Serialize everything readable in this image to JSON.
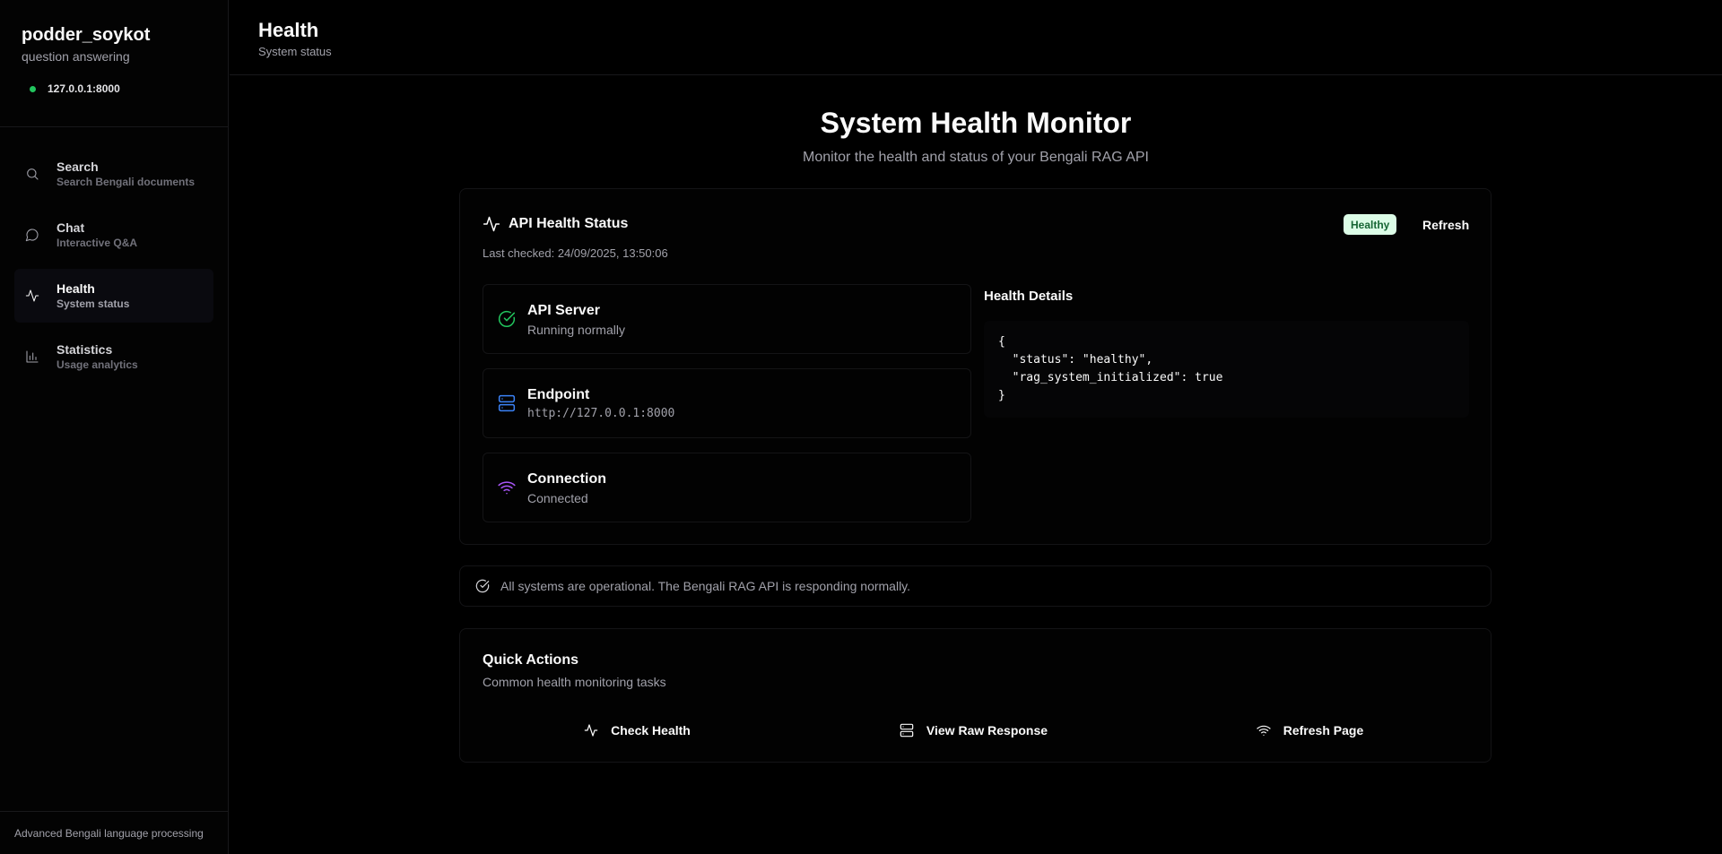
{
  "sidebar": {
    "brand_title": "podder_soykot",
    "brand_subtitle": "question answering",
    "server_address": "127.0.0.1:8000",
    "server_status_color": "#22c55e",
    "items": [
      {
        "label": "Search",
        "description": "Search Bengali documents",
        "icon": "search-icon",
        "active": false
      },
      {
        "label": "Chat",
        "description": "Interactive Q&A",
        "icon": "chat-icon",
        "active": false
      },
      {
        "label": "Health",
        "description": "System status",
        "icon": "activity-icon",
        "active": true
      },
      {
        "label": "Statistics",
        "description": "Usage analytics",
        "icon": "bar-chart-icon",
        "active": false
      }
    ],
    "footer": "Advanced Bengali language processing"
  },
  "header": {
    "title": "Health",
    "subtitle": "System status"
  },
  "hero": {
    "title": "System Health Monitor",
    "subtitle": "Monitor the health and status of your Bengali RAG API"
  },
  "health_card": {
    "title": "API Health Status",
    "last_checked": "Last checked: 24/09/2025, 13:50:06",
    "badge": "Healthy",
    "badge_color": "#dcfce7",
    "refresh_label": "Refresh",
    "items": [
      {
        "title": "API Server",
        "value": "Running normally",
        "icon": "check-circle-icon",
        "color": "#22c55e"
      },
      {
        "title": "Endpoint",
        "value": "http://127.0.0.1:8000",
        "icon": "server-icon",
        "color": "#3b82f6"
      },
      {
        "title": "Connection",
        "value": "Connected",
        "icon": "wifi-icon",
        "color": "#a855f7"
      }
    ],
    "details_title": "Health Details",
    "details_json": "{\n  \"status\": \"healthy\",\n  \"rag_system_initialized\": true\n}"
  },
  "alert": {
    "text": "All systems are operational. The Bengali RAG API is responding normally."
  },
  "quick_actions": {
    "title": "Quick Actions",
    "subtitle": "Common health monitoring tasks",
    "buttons": [
      {
        "label": "Check Health",
        "icon": "activity-icon"
      },
      {
        "label": "View Raw Response",
        "icon": "server-icon"
      },
      {
        "label": "Refresh Page",
        "icon": "wifi-icon"
      }
    ]
  }
}
